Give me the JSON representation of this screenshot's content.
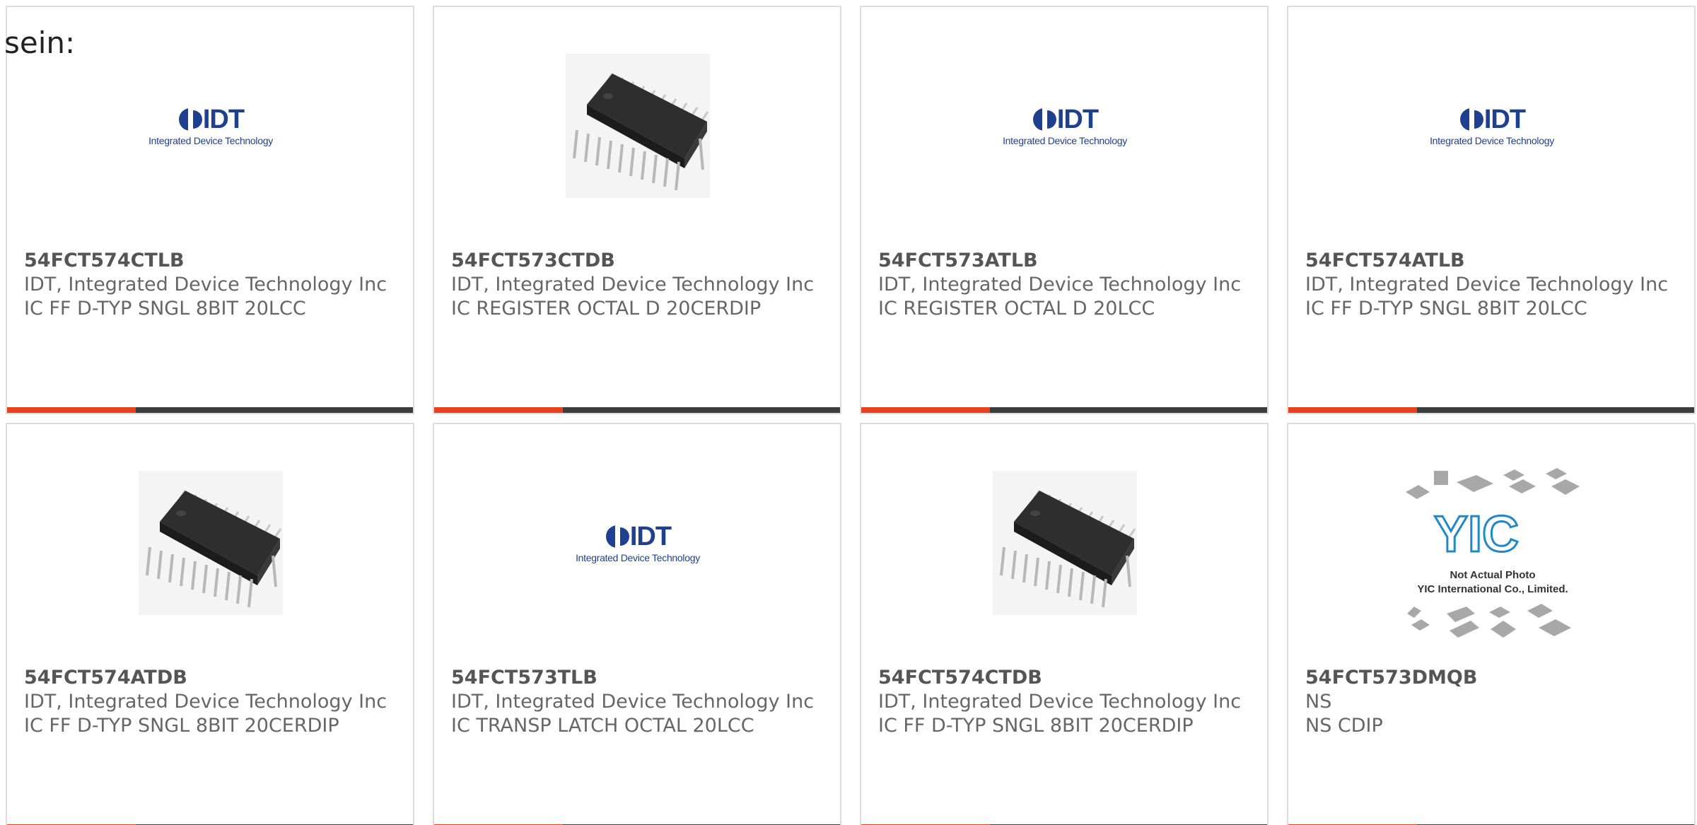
{
  "intro_text": "sein:",
  "products": [
    {
      "part": "54FCT574CTLB",
      "manufacturer": "IDT, Integrated Device Technology Inc",
      "description": "IC FF D-TYP SNGL 8BIT 20LCC",
      "image": "idt-logo"
    },
    {
      "part": "54FCT573CTDB",
      "manufacturer": "IDT, Integrated Device Technology Inc",
      "description": "IC REGISTER OCTAL D 20CERDIP",
      "image": "dip-chip"
    },
    {
      "part": "54FCT573ATLB",
      "manufacturer": "IDT, Integrated Device Technology Inc",
      "description": "IC REGISTER OCTAL D 20LCC",
      "image": "idt-logo"
    },
    {
      "part": "54FCT574ATLB",
      "manufacturer": "IDT, Integrated Device Technology Inc",
      "description": "IC FF D-TYP SNGL 8BIT 20LCC",
      "image": "idt-logo"
    },
    {
      "part": "54FCT574ATDB",
      "manufacturer": "IDT, Integrated Device Technology Inc",
      "description": "IC FF D-TYP SNGL 8BIT 20CERDIP",
      "image": "dip-chip"
    },
    {
      "part": "54FCT573TLB",
      "manufacturer": "IDT, Integrated Device Technology Inc",
      "description": "IC TRANSP LATCH OCTAL 20LCC",
      "image": "idt-logo"
    },
    {
      "part": "54FCT574CTDB",
      "manufacturer": "IDT, Integrated Device Technology Inc",
      "description": "IC FF D-TYP SNGL 8BIT 20CERDIP",
      "image": "dip-chip"
    },
    {
      "part": "54FCT573DMQB",
      "manufacturer": "NS",
      "description": "NS CDIP",
      "image": "yic-placeholder"
    }
  ],
  "logos": {
    "idt_word": "IDT",
    "idt_tagline": "Integrated Device Technology",
    "yic_mark": "YIC",
    "yic_line1": "Not Actual Photo",
    "yic_line2": "YIC International Co., Limited."
  },
  "colors": {
    "accent": "#e8411e",
    "bar": "#3c3c3c",
    "border": "#dcdcdc",
    "text": "#666666",
    "idt_blue": "#1f3f8f",
    "yic_blue": "#1e88c8"
  }
}
